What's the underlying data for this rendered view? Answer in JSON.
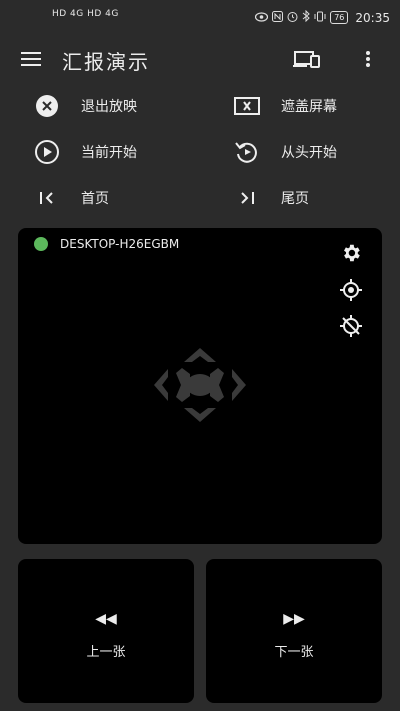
{
  "status_bar": {
    "network_text": "HD 4G HD 4G",
    "battery": "76",
    "time": "20:35"
  },
  "app_bar": {
    "title": "汇报演示",
    "icons": [
      "menu-icon",
      "devices-icon",
      "more-vert-icon"
    ]
  },
  "actions": {
    "exit_show": "退出放映",
    "black_screen": "遮盖屏幕",
    "start_current": "当前开始",
    "start_beginning": "从头开始",
    "first_page": "首页",
    "last_page": "尾页"
  },
  "panel": {
    "device_name": "DESKTOP-H26EGBM",
    "status_color": "#5cb85c"
  },
  "pager": {
    "prev_label": "上一张",
    "next_label": "下一张",
    "prev_arrow": "◀◀",
    "next_arrow": "▶▶"
  }
}
